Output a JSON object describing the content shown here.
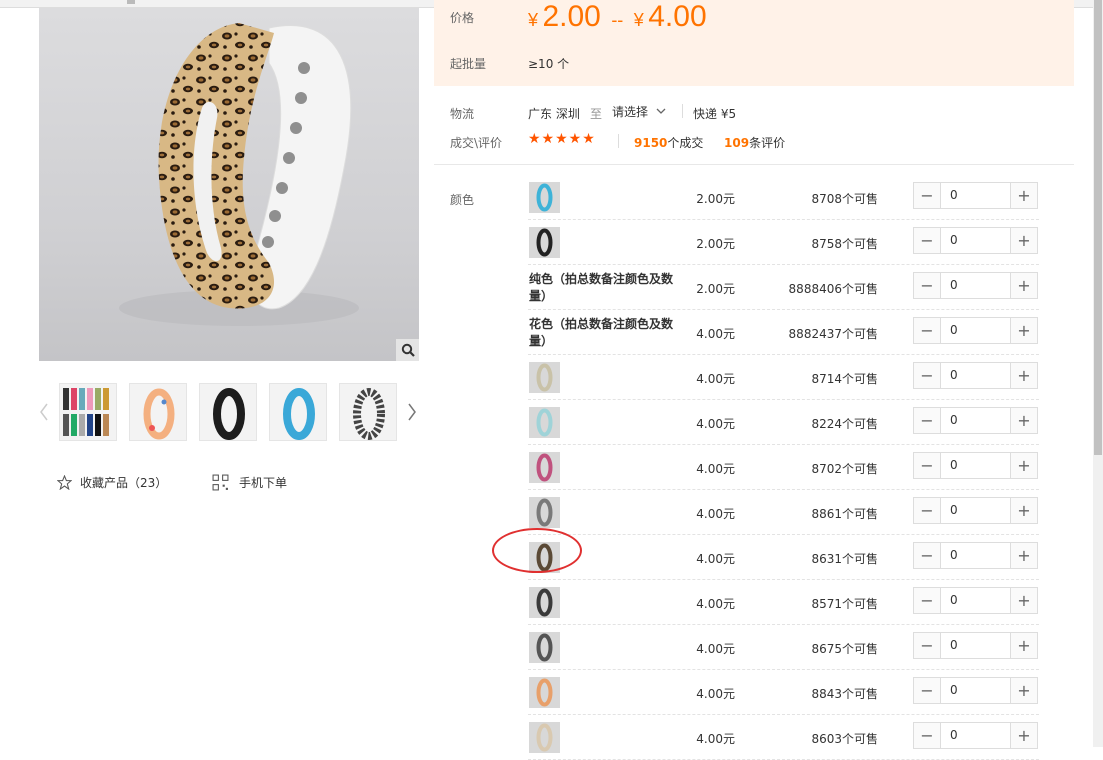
{
  "price": {
    "label": "价格",
    "currency": "¥",
    "min": "2.00",
    "separator": "--",
    "max": "4.00",
    "moq_label": "起批量",
    "moq_value": "≥10 个"
  },
  "logistics": {
    "label": "物流",
    "from": "广东 深圳",
    "to_word": "至",
    "destination_placeholder": "请选择",
    "shipping": "快递 ¥5"
  },
  "reviews": {
    "label": "成交\\评价",
    "stars": "★★★★★",
    "deals_count": "9150",
    "deals_suffix": "个成交",
    "reviews_count": "109",
    "reviews_suffix": "条评价"
  },
  "sku": {
    "label": "颜色",
    "rows": [
      {
        "name": "",
        "thumb_color": "#3eb3d8",
        "price": "2.00元",
        "stock": "8708个可售",
        "qty": "0"
      },
      {
        "name": "",
        "thumb_color": "#222222",
        "price": "2.00元",
        "stock": "8758个可售",
        "qty": "0"
      },
      {
        "name": "纯色（拍总数备注颜色及数量）",
        "thumb_color": "",
        "price": "2.00元",
        "stock": "8888406个可售",
        "qty": "0"
      },
      {
        "name": "花色（拍总数备注颜色及数量）",
        "thumb_color": "",
        "price": "4.00元",
        "stock": "8882437个可售",
        "qty": "0"
      },
      {
        "name": "",
        "thumb_color": "#c9c2a8",
        "price": "4.00元",
        "stock": "8714个可售",
        "qty": "0"
      },
      {
        "name": "",
        "thumb_color": "#9fd3d8",
        "price": "4.00元",
        "stock": "8224个可售",
        "qty": "0"
      },
      {
        "name": "",
        "thumb_color": "#c0527e",
        "price": "4.00元",
        "stock": "8702个可售",
        "qty": "0"
      },
      {
        "name": "",
        "thumb_color": "#7a7a7a",
        "price": "4.00元",
        "stock": "8861个可售",
        "qty": "0"
      },
      {
        "name": "",
        "thumb_color": "#5b4a36",
        "price": "4.00元",
        "stock": "8631个可售",
        "qty": "0"
      },
      {
        "name": "",
        "thumb_color": "#3a3a3a",
        "price": "4.00元",
        "stock": "8571个可售",
        "qty": "0"
      },
      {
        "name": "",
        "thumb_color": "#555555",
        "price": "4.00元",
        "stock": "8675个可售",
        "qty": "0"
      },
      {
        "name": "",
        "thumb_color": "#e8a06a",
        "price": "4.00元",
        "stock": "8843个可售",
        "qty": "0"
      },
      {
        "name": "",
        "thumb_color": "#d9c9b0",
        "price": "4.00元",
        "stock": "8603个可售",
        "qty": "0"
      }
    ]
  },
  "gallery": {
    "favorite_label": "收藏产品（23）",
    "mobile_order_label": "手机下单",
    "thumbs": [
      {
        "color": "#5a6e8c"
      },
      {
        "color": "#f4c0a0"
      },
      {
        "color": "#1d1d1d"
      },
      {
        "color": "#3aa8d8"
      },
      {
        "color": "#ffffff"
      }
    ]
  },
  "colors": {
    "accent": "#ff7300",
    "price_bg": "#fff2e8",
    "star": "#ff5500",
    "annotation": "#e03030"
  }
}
